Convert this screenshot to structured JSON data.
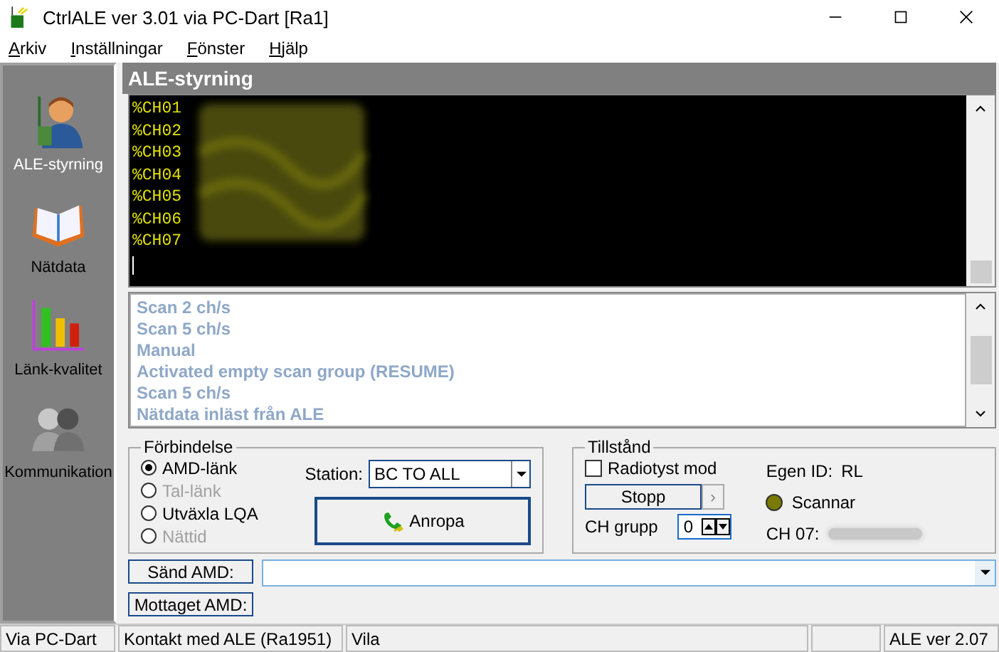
{
  "window": {
    "title": "CtrlALE ver 3.01 via PC-Dart [Ra1]"
  },
  "menu": [
    {
      "label": "Arkiv"
    },
    {
      "label": "Inställningar"
    },
    {
      "label": "Fönster"
    },
    {
      "label": "Hjälp"
    }
  ],
  "sidebar": {
    "items": [
      {
        "label": "ALE-styrning",
        "kind": "operator",
        "selected": true
      },
      {
        "label": "Nätdata",
        "kind": "book",
        "selected": false
      },
      {
        "label": "Länk-kvalitet",
        "kind": "chart",
        "selected": false
      },
      {
        "label": "Kommunikation",
        "kind": "people",
        "selected": false
      }
    ]
  },
  "panel": {
    "title": "ALE-styrning"
  },
  "console": {
    "lines": [
      "%CH01",
      "%CH02",
      "%CH03",
      "%CH04",
      "%CH05",
      "%CH06",
      "%CH07"
    ]
  },
  "log": {
    "lines": [
      "Scan 2 ch/s",
      "Scan 5 ch/s",
      "Manual",
      "Activated empty scan group (RESUME)",
      "Scan 5 ch/s",
      "Nätdata inläst från ALE"
    ]
  },
  "connection": {
    "title": "Förbindelse",
    "options": [
      {
        "label": "AMD-länk",
        "selected": true,
        "disabled": false
      },
      {
        "label": "Tal-länk",
        "selected": false,
        "disabled": true
      },
      {
        "label": "Utväxla LQA",
        "selected": false,
        "disabled": false
      },
      {
        "label": "Nättid",
        "selected": false,
        "disabled": true
      }
    ],
    "station_label": "Station:",
    "station_value": "BC TO ALL",
    "call_button": "Anropa"
  },
  "status": {
    "title": "Tillstånd",
    "radio_silent": {
      "label": "Radiotyst mod",
      "checked": false
    },
    "stop_button": "Stopp",
    "next_button": "›",
    "group_label": "CH grupp",
    "group_value": "0",
    "own_id_label": "Egen ID:",
    "own_id": "RL",
    "state_text": "Scannar",
    "channel_label": "CH 07:"
  },
  "send_button": "Sänd AMD:",
  "received_button": "Mottaget AMD:",
  "status_bar": [
    "Via PC-Dart",
    "Kontakt med ALE (Ra1951)",
    "Vila",
    "ALE ver 2.07"
  ]
}
